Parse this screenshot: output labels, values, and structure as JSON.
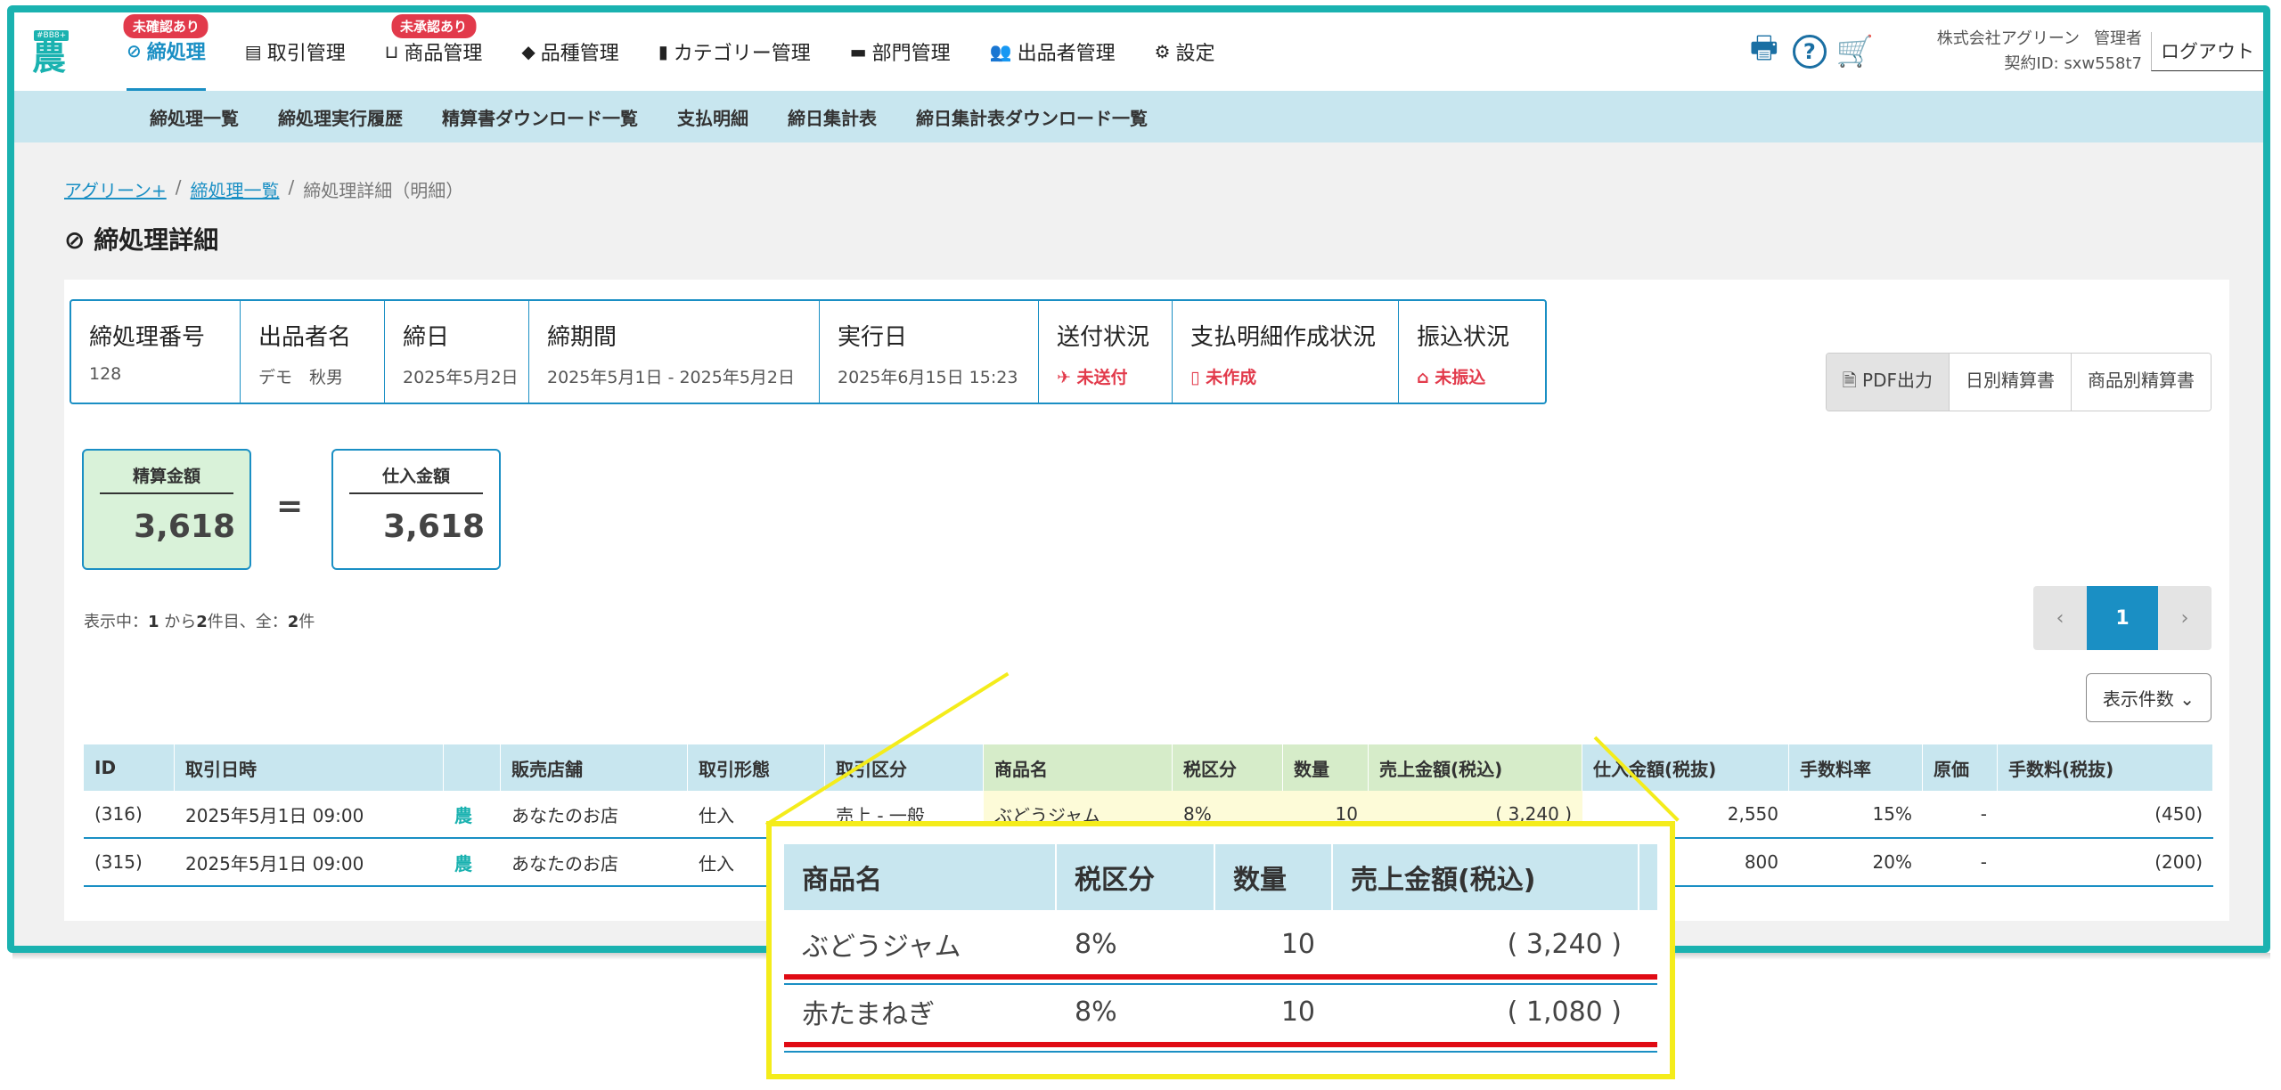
{
  "nav": {
    "logo_tag": "#BB8+",
    "logo_glyph": "農",
    "items": [
      {
        "label": "締処理",
        "badge": "未確認あり",
        "icon": "check-circle-icon"
      },
      {
        "label": "取引管理",
        "badge": "",
        "icon": "receipt-icon"
      },
      {
        "label": "商品管理",
        "badge": "未承認あり",
        "icon": "basket-icon"
      },
      {
        "label": "品種管理",
        "badge": "",
        "icon": "tag-icon"
      },
      {
        "label": "カテゴリー管理",
        "badge": "",
        "icon": "bookmark-icon"
      },
      {
        "label": "部門管理",
        "badge": "",
        "icon": "folder-icon"
      },
      {
        "label": "出品者管理",
        "badge": "",
        "icon": "users-icon"
      },
      {
        "label": "設定",
        "badge": "",
        "icon": "gear-icon"
      }
    ],
    "company": "株式会社アグリーン",
    "role": "管理者",
    "contract": "契約ID: sxw558t7",
    "logout": "ログアウト"
  },
  "subnav": [
    "締処理一覧",
    "締処理実行履歴",
    "精算書ダウンロード一覧",
    "支払明細",
    "締日集計表",
    "締日集計表ダウンロード一覧"
  ],
  "breadcrumb": {
    "root": "アグリーン+",
    "list": "締処理一覧",
    "current": "締処理詳細（明細）"
  },
  "page_title": "締処理詳細",
  "info": {
    "closing_no_label": "締処理番号",
    "closing_no": "128",
    "seller_label": "出品者名",
    "seller": "デモ　秋男",
    "closing_date_label": "締日",
    "closing_date": "2025年5月2日",
    "period_label": "締期間",
    "period": "2025年5月1日 - 2025年5月2日",
    "exec_label": "実行日",
    "exec": "2025年6月15日 15:23",
    "send_label": "送付状況",
    "send": "未送付",
    "statement_label": "支払明細作成状況",
    "statement": "未作成",
    "transfer_label": "振込状況",
    "transfer": "未振込"
  },
  "buttons": {
    "pdf": "PDF出力",
    "daily": "日別精算書",
    "product": "商品別精算書"
  },
  "amounts": {
    "settle_label": "精算金額",
    "settle": "3,618",
    "equals": "=",
    "purchase_label": "仕入金額",
    "purchase": "3,618"
  },
  "showing": {
    "prefix": "表示中：",
    "from": "1",
    "mid1": "から",
    "to": "2",
    "mid2": "件目、全：",
    "total": "2",
    "suffix": "件"
  },
  "pager": {
    "prev": "‹",
    "page": "1",
    "next": "›"
  },
  "per_page": "表示件数",
  "table": {
    "headers": [
      "ID",
      "取引日時",
      "",
      "販売店舗",
      "取引形態",
      "取引区分",
      "商品名",
      "税区分",
      "数量",
      "売上金額(税込)",
      "仕入金額(税抜)",
      "手数料率",
      "原価",
      "手数料(税抜)"
    ],
    "rows": [
      [
        "(316)",
        "2025年5月1日 09:00",
        "農",
        "あなたのお店",
        "仕入",
        "売上 - 一般",
        "ぶどうジャム",
        "8%",
        "10",
        "( 3,240 )",
        "2,550",
        "15%",
        "-",
        "(450)"
      ],
      [
        "(315)",
        "2025年5月1日 09:00",
        "農",
        "あなたのお店",
        "仕入",
        "",
        "",
        "",
        "",
        "",
        "800",
        "20%",
        "-",
        "(200)"
      ]
    ]
  },
  "callout": {
    "headers": [
      "商品名",
      "税区分",
      "数量",
      "売上金額(税込)"
    ],
    "rows": [
      [
        "ぶどうジャム",
        "8%",
        "10",
        "( 3,240 )"
      ],
      [
        "赤たまねぎ",
        "8%",
        "10",
        "( 1,080 )"
      ]
    ]
  }
}
